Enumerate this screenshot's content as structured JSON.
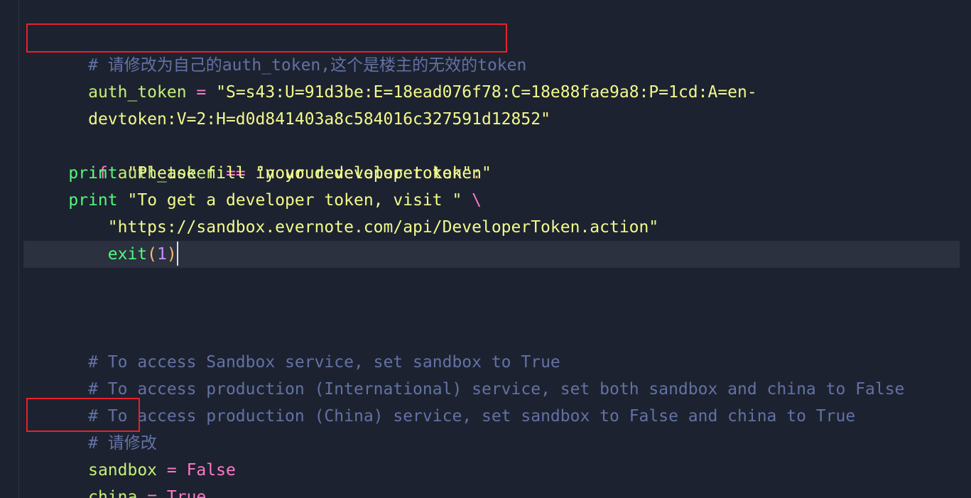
{
  "code": {
    "comment_token_cn": "# 请修改为自己的auth_token,这个是楼主的无效的token",
    "auth_token_name": "auth_token",
    "assign_op": " = ",
    "auth_token_value_part1": "\"S=s43:U=91d3be:E=18ead076f78:C=18e88fae9a8:P=1cd:A=en-",
    "auth_token_value_part2": "devtoken:V=2:H=d0d841403a8c584016c327591d12852\"",
    "if_kw": "if",
    "if_ident": "auth_token",
    "eq_op": " == ",
    "if_string": "\"your developer token\"",
    "colon": ":",
    "print_kw": "print",
    "print1_string": "\"Please fill in your developer token\"",
    "print2_string": "\"To get a developer token, visit \"",
    "backslash": "\\",
    "url_string": "\"https://sandbox.evernote.com/api/DeveloperToken.action\"",
    "exit_func": "exit",
    "paren_open": "(",
    "exit_arg": "1",
    "paren_close": ")",
    "comment_sandbox": "# To access Sandbox service, set sandbox to True",
    "comment_intl": "# To access production (International) service, set both sandbox and china to False",
    "comment_china": "# To access production (China) service, set sandbox to False and china to True",
    "comment_modify_cn": "# 请修改",
    "sandbox_name": "sandbox",
    "sandbox_value": "False",
    "china_name": "china",
    "china_value": "True"
  },
  "colors": {
    "background": "#1d2230",
    "comment": "#6272a4",
    "identifier": "#c5f078",
    "keyword": "#ff79c6",
    "string": "#f1fa8c",
    "function": "#50fa7b",
    "number": "#bd93f9",
    "annotation_box": "#e8212a"
  }
}
